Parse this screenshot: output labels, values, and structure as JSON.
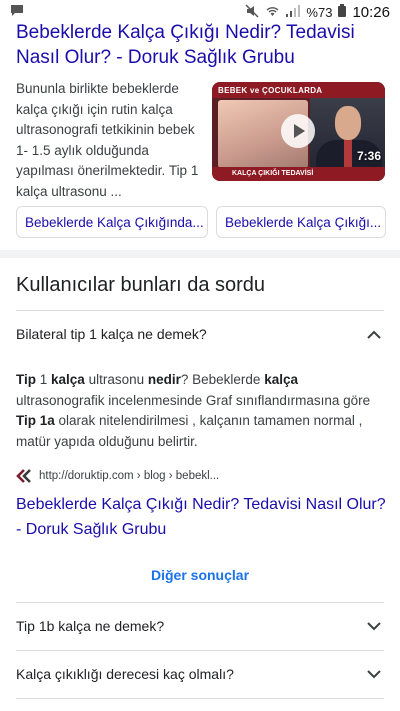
{
  "status_bar": {
    "battery_percent": "%73",
    "time": "10:26"
  },
  "result": {
    "title": "Bebeklerde Kalça Çıkığı Nedir? Tedavisi Nasıl Olur? - Doruk Sağlık Grubu",
    "snippet": "Bununla birlikte bebeklerde kalça çıkığı için rutin kalça ultrasonografi tetkikinin bebek 1- 1.5 aylık olduğunda yapılması önerilmektedir. Tip 1 kalça ultrasonu ...",
    "video": {
      "banner_text": "BEBEK ve ÇOCUKLARDA",
      "caption_text": "KALÇA ÇIKIĞI TEDAVİSİ",
      "duration": "7:36"
    },
    "chips": [
      "Bebeklerde Kalça Çıkığında...",
      "Bebeklerde Kalça Çıkığı..."
    ]
  },
  "paa": {
    "heading": "Kullanıcılar bunları da sordu",
    "expanded_question": "Bilateral tip 1 kalça ne demek?",
    "answer_parts": [
      {
        "text": "Tip",
        "bold": true
      },
      {
        "text": " 1 ",
        "bold": false
      },
      {
        "text": "kalça",
        "bold": true
      },
      {
        "text": " ultrasonu ",
        "bold": false
      },
      {
        "text": "nedir",
        "bold": true
      },
      {
        "text": "? Bebeklerde ",
        "bold": false
      },
      {
        "text": "kalça",
        "bold": true
      },
      {
        "text": " ultrasonografik incelenmesinde Graf sınıflandırmasına göre ",
        "bold": false
      },
      {
        "text": "Tip 1a",
        "bold": true
      },
      {
        "text": " olarak nitelendirilmesi , kalçanın tamamen normal , matür yapıda olduğunu belirtir.",
        "bold": false
      }
    ],
    "source_url": "http://doruktip.com › blog › bebekl...",
    "answer_link": "Bebeklerde Kalça Çıkığı Nedir? Tedavisi Nasıl Olur? - Doruk Sağlık Grubu",
    "more_results": "Diğer sonuçlar",
    "other_questions": [
      "Tip 1b kalça ne demek?",
      "Kalça çıkıklığı derecesi kaç olmalı?"
    ]
  }
}
